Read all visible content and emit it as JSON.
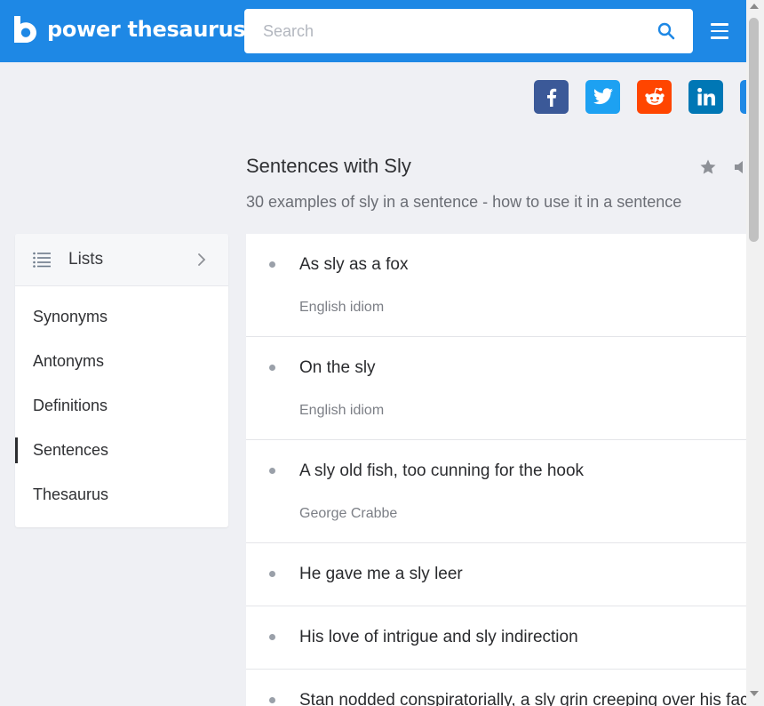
{
  "header": {
    "brand": "power thesaurus",
    "search_placeholder": "Search",
    "search_value": "",
    "brand_color": "#1e88e5"
  },
  "share": [
    {
      "name": "facebook",
      "icon": "facebook-icon",
      "color": "#3b5998"
    },
    {
      "name": "twitter",
      "icon": "twitter-icon",
      "color": "#1da1f2"
    },
    {
      "name": "reddit",
      "icon": "reddit-icon",
      "color": "#ff4500"
    },
    {
      "name": "linkedin",
      "icon": "linkedin-icon",
      "color": "#0077b5"
    },
    {
      "name": "more",
      "icon": "share-icon",
      "color": "#1e88e5"
    }
  ],
  "page": {
    "title": "Sentences with Sly",
    "subtitle": "30 examples of sly in a sentence - how to use it in a sentence"
  },
  "sidebar": {
    "heading": "Lists",
    "items": [
      {
        "label": "Synonyms",
        "active": false
      },
      {
        "label": "Antonyms",
        "active": false
      },
      {
        "label": "Definitions",
        "active": false
      },
      {
        "label": "Sentences",
        "active": true
      },
      {
        "label": "Thesaurus",
        "active": false
      }
    ]
  },
  "sentences": [
    {
      "text": "As sly as a fox",
      "source": "English idiom"
    },
    {
      "text": "On the sly",
      "source": "English idiom"
    },
    {
      "text": "A sly old fish, too cunning for the hook",
      "source": "George Crabbe"
    },
    {
      "text": "He gave me a sly leer",
      "source": ""
    },
    {
      "text": "His love of intrigue and sly indirection",
      "source": ""
    },
    {
      "text": "Stan nodded conspiratorially, a sly grin creeping over his face",
      "source": ""
    }
  ]
}
